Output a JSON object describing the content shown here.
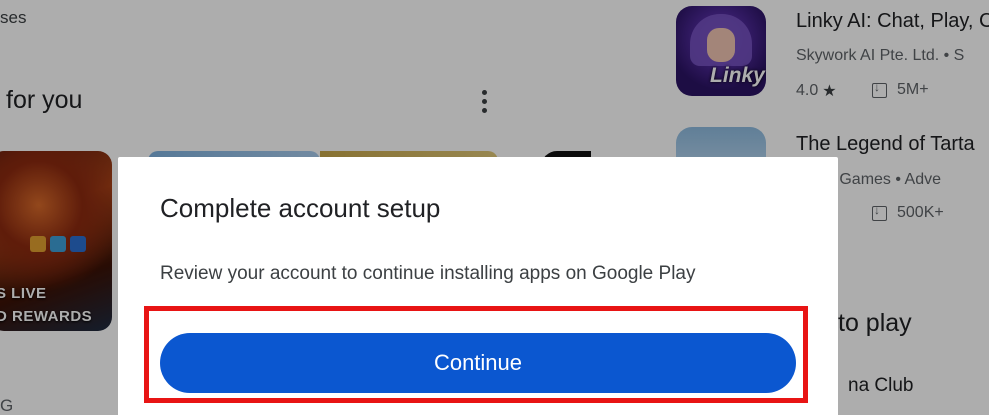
{
  "background": {
    "top_left_text": "ses",
    "section_title": "for you",
    "game_card": {
      "line1": "S LIVE",
      "line2": "D REWARDS"
    },
    "bottom_left_text": "G",
    "apps": [
      {
        "title": "Linky AI: Chat, Play, C",
        "developer": "Skywork AI Pte. Ltd. • S",
        "rating": "4.0",
        "rating_star": "★",
        "downloads": "5M+",
        "icon": "linky-icon",
        "icon_text": "Linky"
      },
      {
        "title": "The Legend of Tarta",
        "developer": "yak Games • Adve",
        "downloads": "500K+",
        "icon": "legend-of-tartar-icon"
      }
    ],
    "right_section_title": "to play",
    "right_item_text": "na Club"
  },
  "dialog": {
    "title": "Complete account setup",
    "body": "Review your account to continue installing apps on Google Play",
    "continue_label": "Continue"
  },
  "colors": {
    "primary_button": "#0b57d0",
    "highlight_border": "#e81414",
    "scrim": "rgba(0,0,0,0.32)"
  }
}
